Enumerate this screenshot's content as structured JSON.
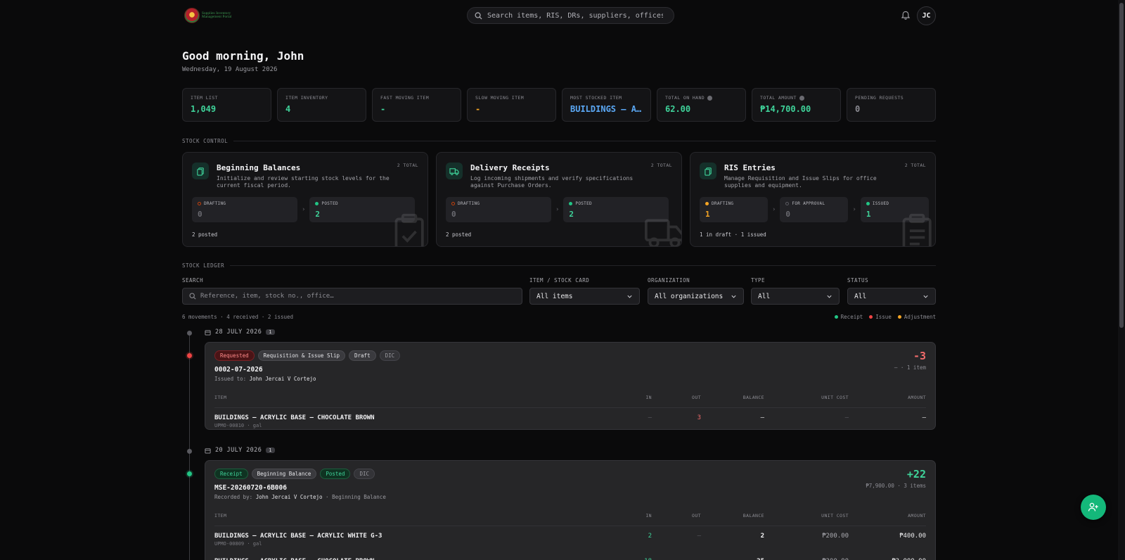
{
  "header": {
    "search_placeholder": "Search items, RIS, DRs, suppliers, offices, p",
    "user_initials": "JC",
    "logo_line1": "Supplies Inventory",
    "logo_line2": "Management Portal"
  },
  "greeting": "Good morning, John",
  "date": "Wednesday, 19 August 2026",
  "kpis": [
    {
      "label": "ITEM LIST",
      "value": "1,049",
      "color": "#3fd39a",
      "info": false
    },
    {
      "label": "ITEM INVENTORY",
      "value": "4",
      "color": "#3fd39a",
      "info": false
    },
    {
      "label": "FAST MOVING ITEM",
      "value": "-",
      "color": "#3fd39a",
      "info": false
    },
    {
      "label": "SLOW MOVING ITEM",
      "value": "-",
      "color": "#f5a524",
      "info": false
    },
    {
      "label": "MOST STOCKED ITEM",
      "value": "BUILDINGS — A…",
      "color": "#5ba8f5",
      "info": false
    },
    {
      "label": "TOTAL ON HAND",
      "value": "62.00",
      "color": "#3fd39a",
      "info": true
    },
    {
      "label": "TOTAL AMOUNT",
      "value": "₱14,700.00",
      "color": "#3fd39a",
      "info": true
    },
    {
      "label": "PENDING REQUESTS",
      "value": "0",
      "color": "#8b8b92",
      "info": false
    }
  ],
  "stock_control": {
    "heading": "STOCK CONTROL",
    "cards": [
      {
        "title": "Beginning Balances",
        "total": "2 TOTAL",
        "desc": "Initialize and review starting stock levels for the current fiscal period.",
        "stages": [
          {
            "label": "DRAFTING",
            "value": "0",
            "dot": "#c2410c",
            "hollow": true,
            "color": "#6a6a70",
            "width": 150
          },
          {
            "label": "POSTED",
            "value": "2",
            "dot": "#22c585",
            "hollow": false,
            "color": "#3fd39a",
            "width": 150
          }
        ],
        "footer": "2 posted"
      },
      {
        "title": "Delivery Receipts",
        "total": "2 TOTAL",
        "desc": "Log incoming shipments and verify specifications against Purchase Orders.",
        "stages": [
          {
            "label": "DRAFTING",
            "value": "0",
            "dot": "#c2410c",
            "hollow": true,
            "color": "#6a6a70",
            "width": 150
          },
          {
            "label": "POSTED",
            "value": "2",
            "dot": "#22c585",
            "hollow": false,
            "color": "#3fd39a",
            "width": 150
          }
        ],
        "footer": "2 posted"
      },
      {
        "title": "RIS Entries",
        "total": "2 TOTAL",
        "desc": "Manage Requisition and Issue Slips for office supplies and equipment.",
        "stages": [
          {
            "label": "DRAFTING",
            "value": "1",
            "dot": "#f5a524",
            "hollow": false,
            "color": "#f5a524",
            "width": 97
          },
          {
            "label": "FOR APPROVAL",
            "value": "0",
            "dot": "#5a5a60",
            "hollow": true,
            "color": "#6a6a70",
            "width": 97
          },
          {
            "label": "ISSUED",
            "value": "1",
            "dot": "#22c585",
            "hollow": false,
            "color": "#3fd39a",
            "width": 97
          }
        ],
        "footer": "1 in draft · 1 issued"
      }
    ]
  },
  "ledger": {
    "heading": "STOCK LEDGER",
    "filters": {
      "search_label": "SEARCH",
      "search_placeholder": "Reference, item, stock no., office…",
      "item_label": "ITEM / STOCK CARD",
      "item_value": "All items",
      "org_label": "ORGANIZATION",
      "org_value": "All organizations",
      "type_label": "TYPE",
      "type_value": "All",
      "status_label": "STATUS",
      "status_value": "All"
    },
    "summary": "6 movements · 4 received · 2 issued",
    "legend": [
      {
        "label": "Receipt",
        "color": "#22c585"
      },
      {
        "label": "Issue",
        "color": "#ef4444"
      },
      {
        "label": "Adjustment",
        "color": "#f5a524"
      }
    ],
    "columns": [
      "ITEM",
      "IN",
      "OUT",
      "BALANCE",
      "UNIT COST",
      "AMOUNT"
    ],
    "groups": [
      {
        "date": "28 JULY 2026",
        "count": "1",
        "movement": {
          "badges": [
            {
              "text": "Requested",
              "style": "red"
            },
            {
              "text": "Requisition & Issue Slip",
              "style": "gray"
            },
            {
              "text": "Draft",
              "style": "gray"
            },
            {
              "text": "DIC",
              "style": "dim"
            }
          ],
          "ref": "0002-07-2026",
          "by_label": "Issued to:",
          "by_name": "John Jercai V Cortejo",
          "by_extra": "",
          "qty": "-3",
          "qty_color": "#f06b6b",
          "sub": "— · 1 item",
          "rows": [
            {
              "name": "BUILDINGS — ACRYLIC BASE — CHOCOLATE BROWN",
              "code": "UPMO-00810 · gal",
              "in": "—",
              "out": "3",
              "balance": "—",
              "unit_cost": "—",
              "amount": "—"
            }
          ]
        }
      },
      {
        "date": "20 JULY 2026",
        "count": "1",
        "movement": {
          "badges": [
            {
              "text": "Receipt",
              "style": "green"
            },
            {
              "text": "Beginning Balance",
              "style": "gray"
            },
            {
              "text": "Posted",
              "style": "green"
            },
            {
              "text": "DIC",
              "style": "dim"
            }
          ],
          "ref": "MSE-20260720-6B006",
          "by_label": "Recorded by:",
          "by_name": "John Jercai V Cortejo",
          "by_extra": "· Beginning Balance",
          "qty": "+22",
          "qty_color": "#3fd39a",
          "sub": "₱7,900.00 · 3 items",
          "rows": [
            {
              "name": "BUILDINGS — ACRYLIC BASE — ACRYLIC WHITE G-3",
              "code": "UPMO-00809 · gal",
              "in": "2",
              "out": "—",
              "balance": "2",
              "unit_cost": "₱200.00",
              "amount": "₱400.00"
            },
            {
              "name": "BUILDINGS — ACRYLIC BASE — CHOCOLATE BROWN",
              "code": "UPMO-00810 · gal",
              "in": "18",
              "out": "—",
              "balance": "25",
              "unit_cost": "₱300.00",
              "amount": "₱3,000.00"
            }
          ]
        }
      }
    ]
  }
}
